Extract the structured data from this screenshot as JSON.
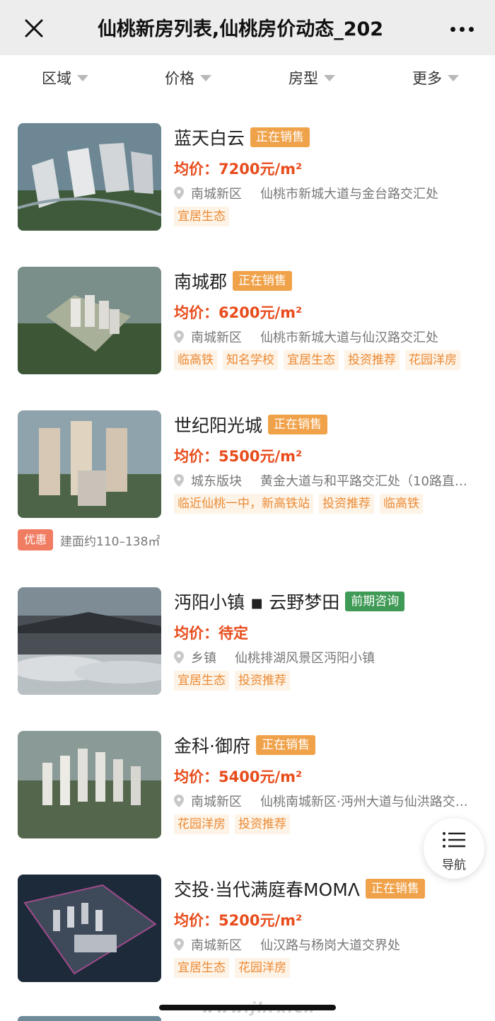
{
  "header": {
    "title": "仙桃新房列表,仙桃房价动态_202"
  },
  "filters": [
    {
      "label": "区域"
    },
    {
      "label": "价格"
    },
    {
      "label": "房型"
    },
    {
      "label": "更多"
    }
  ],
  "listings": [
    {
      "name": "蓝天白云",
      "status": "正在销售",
      "price": "均价：7200元/m²",
      "district": "南城新区",
      "address": "仙桃市新城大道与金台路交汇处",
      "tags": [
        "宜居生态"
      ]
    },
    {
      "name": "南城郡",
      "status": "正在销售",
      "price": "均价：6200元/m²",
      "district": "南城新区",
      "address": "仙桃市新城大道与仙汉路交汇处",
      "tags": [
        "临高铁",
        "知名学校",
        "宜居生态",
        "投资推荐",
        "花园洋房"
      ]
    },
    {
      "name": "世纪阳光城",
      "status": "正在销售",
      "price": "均价：5500元/m²",
      "district": "城东版块",
      "address": "黄金大道与和平路交汇处（10路直…",
      "tags": [
        "临近仙桃一中，新高铁站",
        "投资推荐",
        "临高铁"
      ],
      "promo": {
        "badge": "优惠",
        "text": "建面约110–138㎡"
      }
    },
    {
      "name": "沔阳小镇 ◾ 云野梦田",
      "status": "前期咨询",
      "price": "均价：待定",
      "district": "乡镇",
      "address": "仙桃排湖风景区沔阳小镇",
      "tags": [
        "宜居生态",
        "投资推荐"
      ]
    },
    {
      "name": "金科·御府",
      "status": "正在销售",
      "price": "均价：5400元/m²",
      "district": "南城新区",
      "address": "仙桃南城新区·沔州大道与仙洪路交…",
      "tags": [
        "花园洋房",
        "投资推荐"
      ]
    },
    {
      "name": "交投·当代满庭春MOMΛ",
      "status": "正在销售",
      "price": "均价：5200元/m²",
      "district": "南城新区",
      "address": "仙汉路与杨岗大道交界处",
      "tags": [
        "宜居生态",
        "花园洋房"
      ]
    }
  ],
  "nav_button": {
    "label": "导航"
  },
  "watermark": "www.jhrx.cn",
  "colors": {
    "price": "#e84c1c",
    "status_sale": "#f0a24a",
    "status_pre": "#3f9a55",
    "tag_text": "#ec8a35",
    "tag_bg": "#fdf3e6",
    "promo": "#f07c62"
  },
  "icons": [
    "close-icon",
    "more-icon",
    "caret-down-icon",
    "location-pin-icon",
    "menu-list-icon"
  ]
}
